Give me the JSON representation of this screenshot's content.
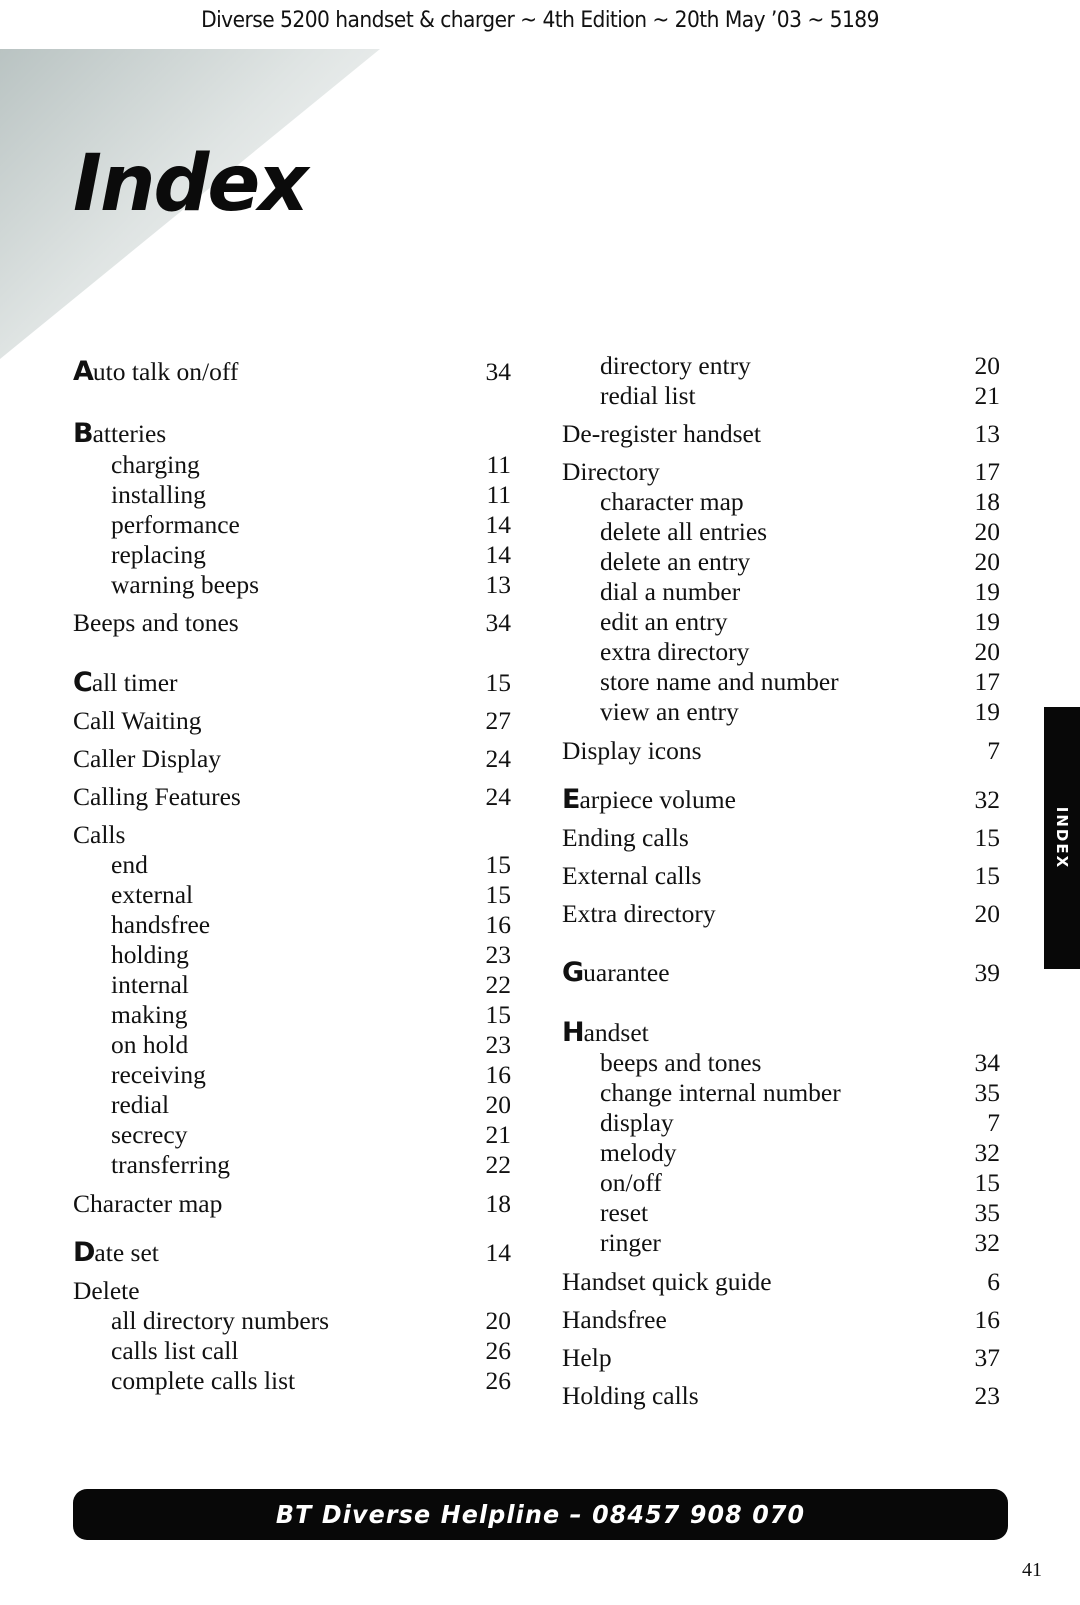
{
  "header": {
    "running_head": "Diverse 5200 handset & charger ~ 4th Edition ~ 20th May ’03 ~ 5189",
    "title": "Index"
  },
  "index": {
    "left": [
      {
        "initial": "A",
        "term": "uto talk on/off",
        "page": "34",
        "level": 0
      },
      {
        "initial": "B",
        "term": "atteries",
        "page": "",
        "level": 0
      },
      {
        "term": "charging",
        "page": "11",
        "level": 1
      },
      {
        "term": "installing",
        "page": "11",
        "level": 1
      },
      {
        "term": "performance",
        "page": "14",
        "level": 1
      },
      {
        "term": "replacing",
        "page": "14",
        "level": 1
      },
      {
        "term": "warning beeps",
        "page": "13",
        "level": 1
      },
      {
        "term": "Beeps and tones",
        "page": "34",
        "level": 0
      },
      {
        "initial": "C",
        "term": "all timer",
        "page": "15",
        "level": 0
      },
      {
        "term": "Call Waiting",
        "page": "27",
        "level": 0
      },
      {
        "term": "Caller Display",
        "page": "24",
        "level": 0
      },
      {
        "term": "Calling Features",
        "page": "24",
        "level": 0
      },
      {
        "term": "Calls",
        "page": "",
        "level": 0
      },
      {
        "term": "end",
        "page": "15",
        "level": 1
      },
      {
        "term": "external",
        "page": "15",
        "level": 1
      },
      {
        "term": "handsfree",
        "page": "16",
        "level": 1
      },
      {
        "term": "holding",
        "page": "23",
        "level": 1
      },
      {
        "term": "internal",
        "page": "22",
        "level": 1
      },
      {
        "term": "making",
        "page": "15",
        "level": 1
      },
      {
        "term": "on hold",
        "page": "23",
        "level": 1
      },
      {
        "term": "receiving",
        "page": "16",
        "level": 1
      },
      {
        "term": "redial",
        "page": "20",
        "level": 1
      },
      {
        "term": "secrecy",
        "page": "21",
        "level": 1
      },
      {
        "term": "transferring",
        "page": "22",
        "level": 1
      },
      {
        "term": "Character map",
        "page": "18",
        "level": 0
      },
      {
        "initial": "D",
        "term": "ate set",
        "page": "14",
        "level": 0
      },
      {
        "term": "Delete",
        "page": "",
        "level": 0
      },
      {
        "term": "all directory numbers",
        "page": "20",
        "level": 1
      },
      {
        "term": "calls list call",
        "page": "26",
        "level": 1
      },
      {
        "term": "complete calls list",
        "page": "26",
        "level": 1
      }
    ],
    "right": [
      {
        "term": "directory entry",
        "page": "20",
        "level": 1
      },
      {
        "term": "redial list",
        "page": "21",
        "level": 1
      },
      {
        "term": "De-register handset",
        "page": "13",
        "level": 0
      },
      {
        "term": "Directory",
        "page": "17",
        "level": 0
      },
      {
        "term": "character map",
        "page": "18",
        "level": 1
      },
      {
        "term": "delete all entries",
        "page": "20",
        "level": 1
      },
      {
        "term": "delete an entry",
        "page": "20",
        "level": 1
      },
      {
        "term": "dial a number",
        "page": "19",
        "level": 1
      },
      {
        "term": "edit an entry",
        "page": "19",
        "level": 1
      },
      {
        "term": "extra directory",
        "page": "20",
        "level": 1
      },
      {
        "term": "store name and number",
        "page": "17",
        "level": 1
      },
      {
        "term": "view an entry",
        "page": "19",
        "level": 1
      },
      {
        "term": "Display icons",
        "page": "7",
        "level": 0
      },
      {
        "initial": "E",
        "term": "arpiece volume",
        "page": "32",
        "level": 0
      },
      {
        "term": "Ending calls",
        "page": "15",
        "level": 0
      },
      {
        "term": "External calls",
        "page": "15",
        "level": 0
      },
      {
        "term": "Extra directory",
        "page": "20",
        "level": 0
      },
      {
        "initial": "G",
        "term": "uarantee",
        "page": "39",
        "level": 0
      },
      {
        "initial": "H",
        "term": "andset",
        "page": "",
        "level": 0
      },
      {
        "term": "beeps and tones",
        "page": "34",
        "level": 1
      },
      {
        "term": "change internal number",
        "page": "35",
        "level": 1
      },
      {
        "term": "display",
        "page": "7",
        "level": 1
      },
      {
        "term": "melody",
        "page": "32",
        "level": 1
      },
      {
        "term": "on/off",
        "page": "15",
        "level": 1
      },
      {
        "term": "reset",
        "page": "35",
        "level": 1
      },
      {
        "term": "ringer",
        "page": "32",
        "level": 1
      },
      {
        "term": "Handset quick guide",
        "page": "6",
        "level": 0
      },
      {
        "term": "Handsfree",
        "page": "16",
        "level": 0
      },
      {
        "term": "Help",
        "page": "37",
        "level": 0
      },
      {
        "term": "Holding calls",
        "page": "23",
        "level": 0
      }
    ]
  },
  "side_tab": {
    "label": "INDEX"
  },
  "footer": {
    "helpline": "BT Diverse Helpline – 08457 908 070",
    "page_number": "41"
  }
}
